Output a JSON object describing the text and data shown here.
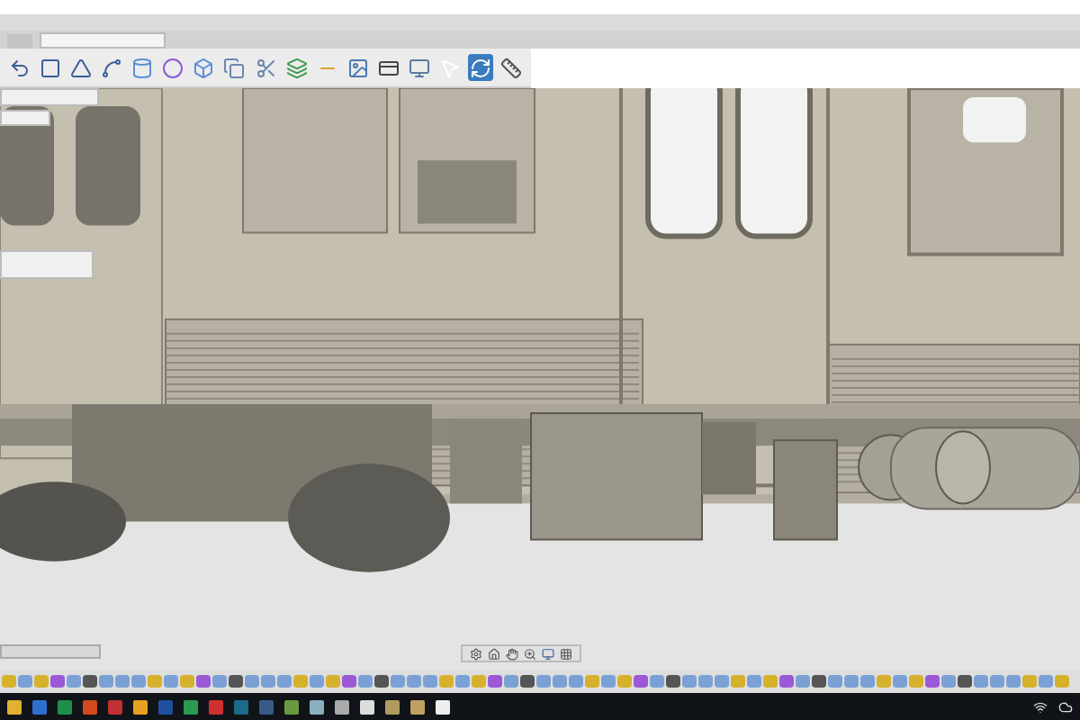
{
  "document_tabs": [
    {
      "selected": false
    },
    {
      "selected": true
    }
  ],
  "toolbar": {
    "tools": [
      {
        "selected": false
      },
      {
        "selected": false
      },
      {
        "selected": false
      },
      {
        "selected": false
      },
      {
        "selected": false
      },
      {
        "selected": false
      },
      {
        "selected": false
      },
      {
        "selected": false
      },
      {
        "selected": false
      },
      {
        "selected": false
      },
      {
        "selected": false
      },
      {
        "selected": false
      },
      {
        "selected": false
      },
      {
        "selected": false
      },
      {
        "selected": false
      },
      {
        "selected": true
      },
      {
        "selected": false
      }
    ]
  }
}
